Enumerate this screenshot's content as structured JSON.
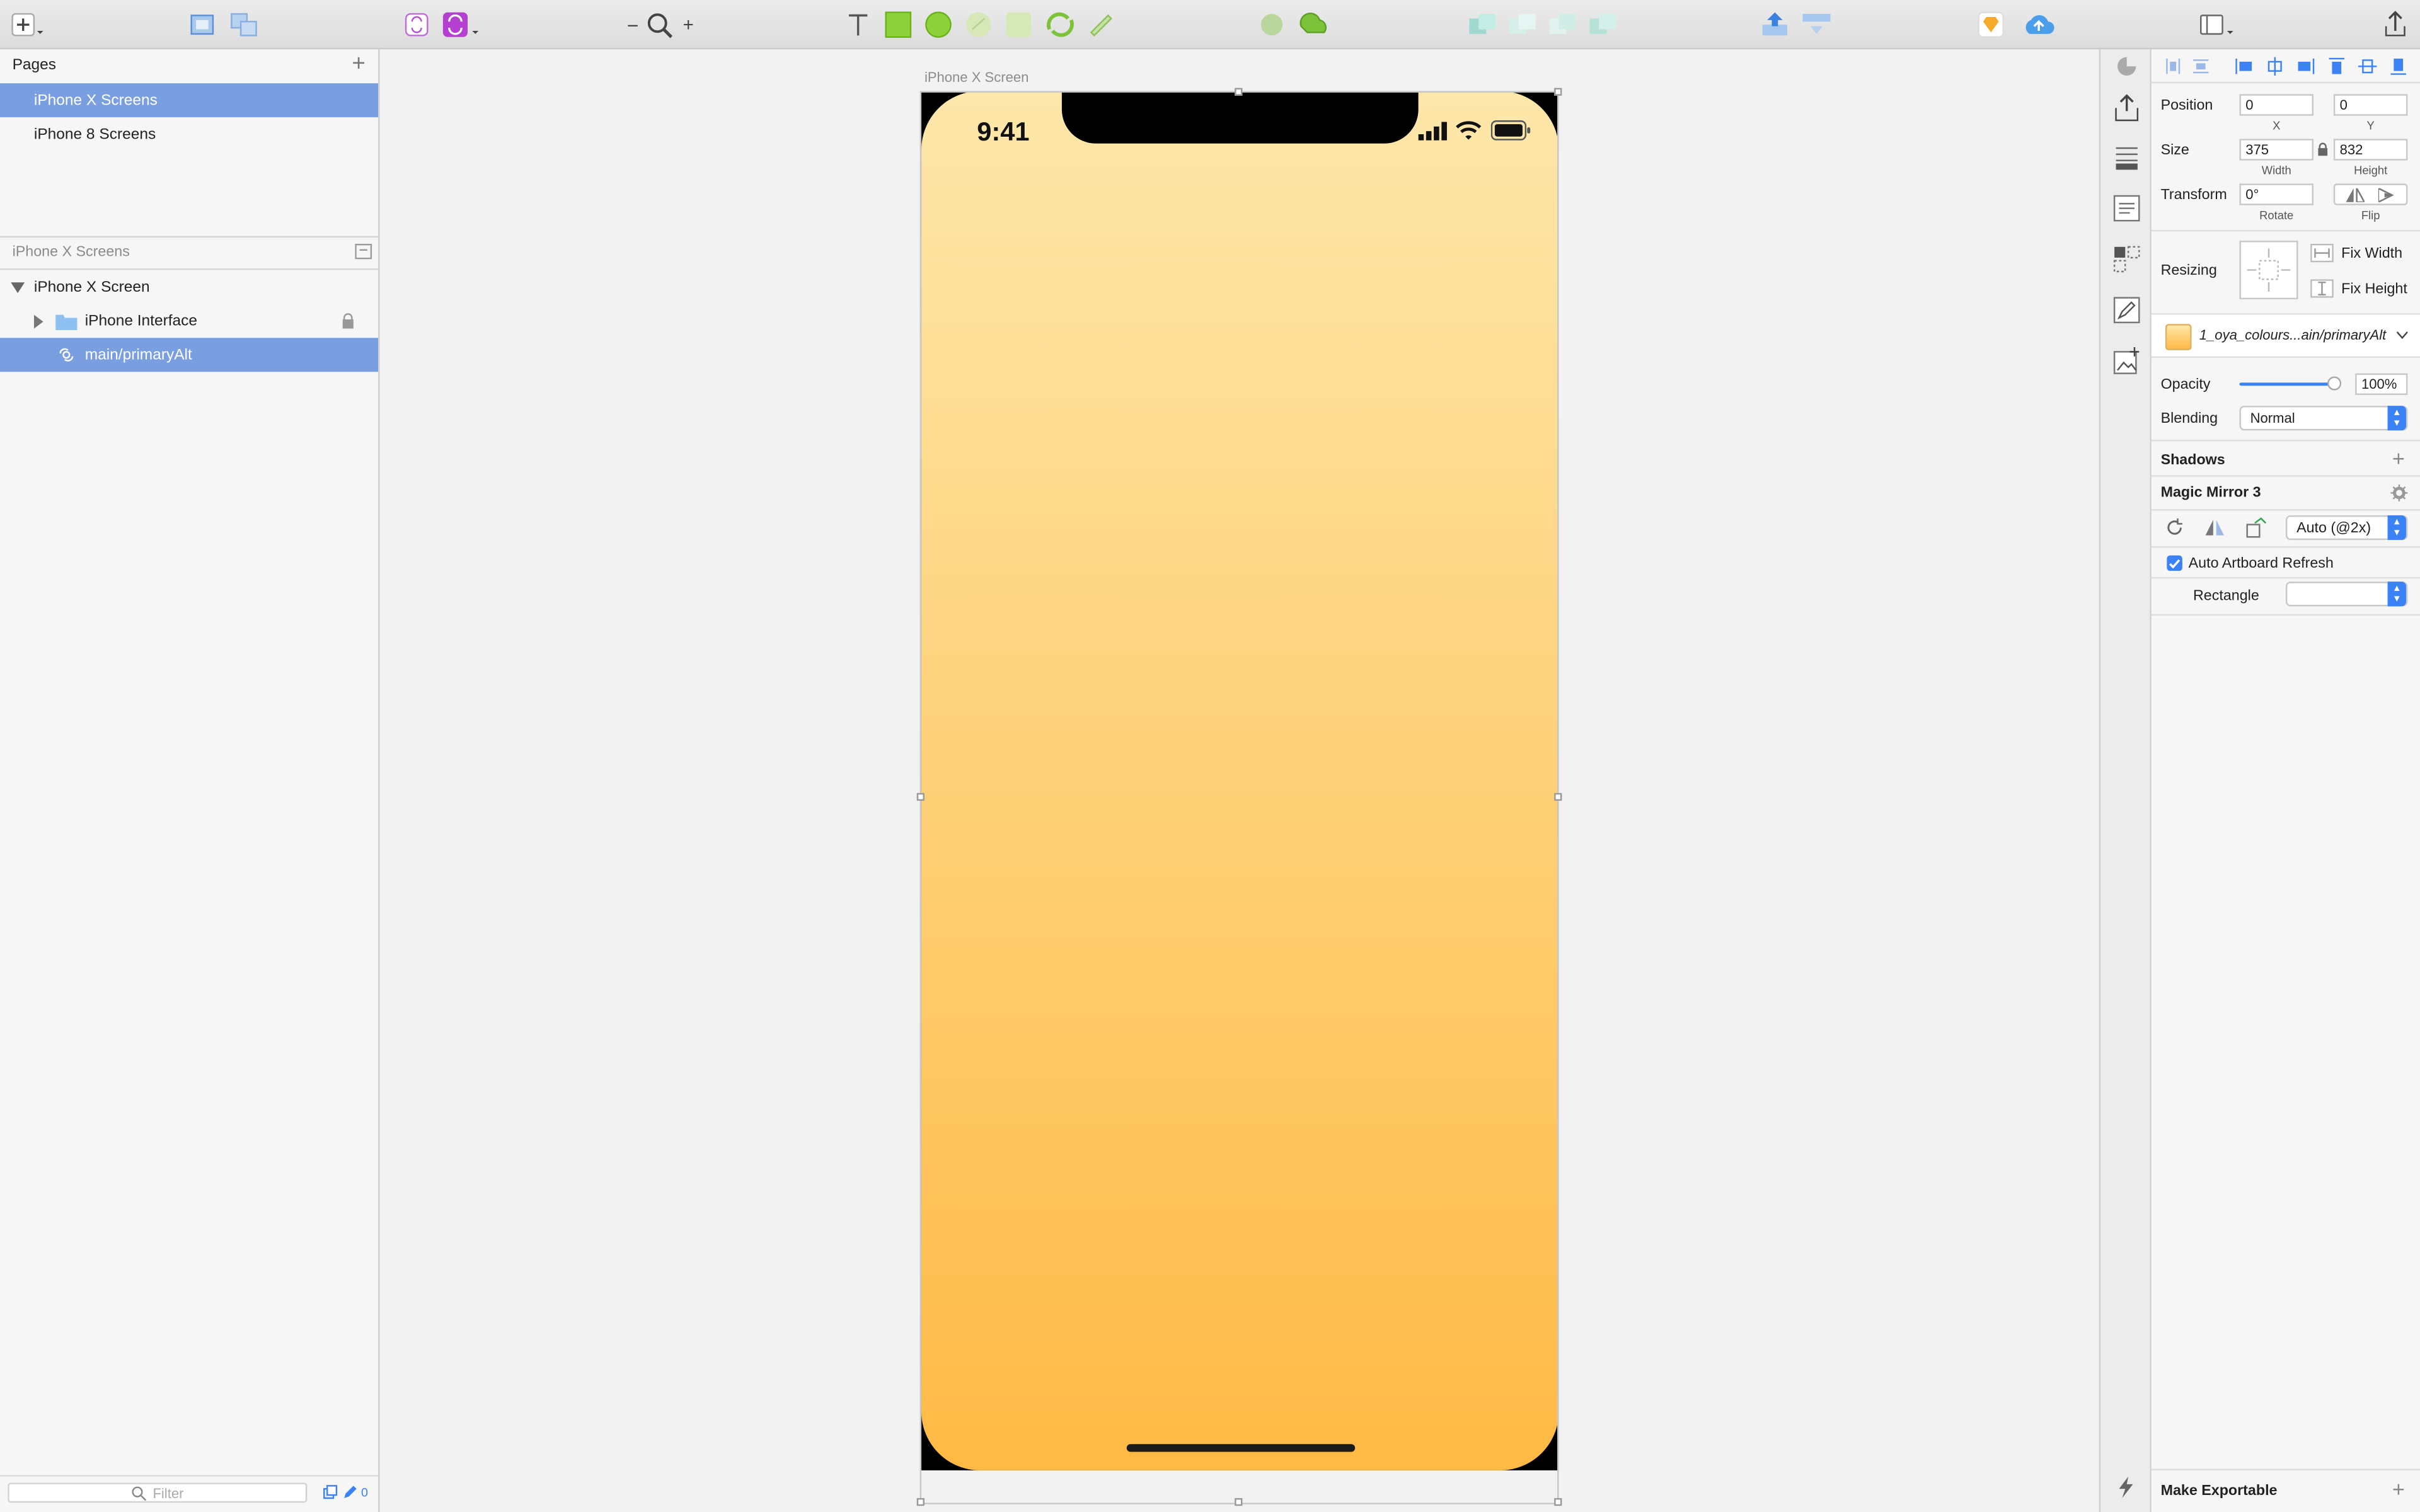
{
  "toolbar": {
    "icons": [
      "insert-icon",
      "group-icon",
      "ungroup-icon",
      "create-symbol-icon",
      "symbol-icon",
      "zoom-out-icon",
      "zoom-icon",
      "zoom-in-icon",
      "text-icon",
      "rectangle-icon",
      "oval-icon",
      "rounded-icon",
      "star-icon",
      "rotate-icon",
      "flatten-icon",
      "union-icon",
      "subtract-icon",
      "intersect-icon",
      "difference-icon",
      "mask-icon",
      "scissors-icon",
      "forward-icon",
      "backward-icon",
      "front-icon",
      "back-icon",
      "export-icon",
      "sketch-icon",
      "cloud-icon",
      "view-icon",
      "share-icon"
    ],
    "zoom_minus": "−",
    "zoom_plus": "+"
  },
  "pages": {
    "title": "Pages",
    "items": [
      {
        "label": "iPhone X Screens",
        "selected": true
      },
      {
        "label": "iPhone 8 Screens",
        "selected": false
      }
    ]
  },
  "layers": {
    "section_title": "iPhone X Screens",
    "artboard": "iPhone X Screen",
    "group": "iPhone Interface",
    "symbol": "main/primaryAlt"
  },
  "filter": {
    "placeholder": "Filter",
    "count": "0"
  },
  "canvas": {
    "artboard_label": "iPhone X Screen",
    "status_time": "9:41",
    "gradient_top": "#fde7aa",
    "gradient_bottom": "#ffba45"
  },
  "inspector": {
    "position_label": "Position",
    "x": "0",
    "y": "0",
    "x_label": "X",
    "y_label": "Y",
    "size_label": "Size",
    "width": "375",
    "height": "832",
    "width_label": "Width",
    "height_label": "Height",
    "transform_label": "Transform",
    "rotate": "0°",
    "rotate_label": "Rotate",
    "flip_label": "Flip",
    "resizing_label": "Resizing",
    "fix_width": "Fix Width",
    "fix_height": "Fix Height",
    "symbol_name": "1_oya_colours...ain/primaryAlt",
    "opacity_label": "Opacity",
    "opacity": "100%",
    "opacity_value": 1.0,
    "blending_label": "Blending",
    "blending": "Normal",
    "shadows": "Shadows",
    "plugin": "Magic Mirror 3",
    "scale": "Auto (@2x)",
    "auto_refresh": "Auto Artboard Refresh",
    "auto_refresh_checked": true,
    "rectangle_label": "Rectangle",
    "make_exportable": "Make Exportable"
  }
}
